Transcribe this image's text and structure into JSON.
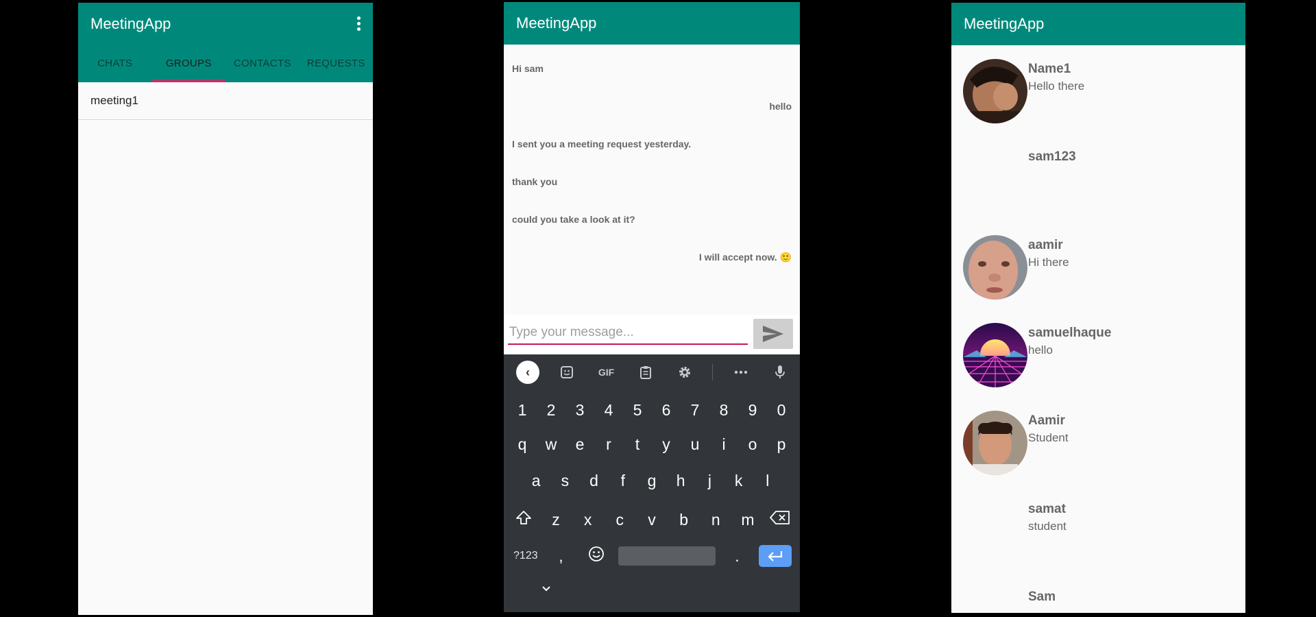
{
  "app_title": "MeetingApp",
  "screen1": {
    "tabs": [
      {
        "label": "CHATS"
      },
      {
        "label": "GROUPS"
      },
      {
        "label": "CONTACTS"
      },
      {
        "label": "REQUESTS"
      }
    ],
    "active_tab": "GROUPS",
    "groups": [
      {
        "name": "meeting1"
      }
    ]
  },
  "screen2": {
    "messages": [
      {
        "text": "Hi sam",
        "side": "left"
      },
      {
        "text": "hello",
        "side": "right"
      },
      {
        "text": "I sent you a meeting request yesterday.",
        "side": "left"
      },
      {
        "text": "thank you",
        "side": "left"
      },
      {
        "text": "could you take a look at it?",
        "side": "left"
      },
      {
        "text": "I will accept now. 🙂",
        "side": "right"
      }
    ],
    "input": {
      "placeholder": "Type your message...",
      "value": ""
    },
    "keyboard": {
      "toolbar": [
        "back-arrow-icon",
        "sticker-icon",
        "GIF",
        "clipboard-icon",
        "gear-icon",
        "more-icon",
        "mic-icon"
      ],
      "gif_label": "GIF",
      "row_numbers": [
        "1",
        "2",
        "3",
        "4",
        "5",
        "6",
        "7",
        "8",
        "9",
        "0"
      ],
      "row_q": [
        "q",
        "w",
        "e",
        "r",
        "t",
        "y",
        "u",
        "i",
        "o",
        "p"
      ],
      "row_a": [
        "a",
        "s",
        "d",
        "f",
        "g",
        "h",
        "j",
        "k",
        "l"
      ],
      "row_z": [
        "z",
        "x",
        "c",
        "v",
        "b",
        "n",
        "m"
      ],
      "symbols_label": "?123",
      "comma": ",",
      "period": "."
    }
  },
  "screen3": {
    "contacts": [
      {
        "name": "Name1",
        "status": "Hello there",
        "avatar": "photo"
      },
      {
        "name": "sam123",
        "status": "",
        "avatar": "none"
      },
      {
        "name": "aamir",
        "status": "Hi there",
        "avatar": "photo"
      },
      {
        "name": "samuelhaque",
        "status": "hello",
        "avatar": "synthwave"
      },
      {
        "name": "Aamir",
        "status": "Student",
        "avatar": "photo"
      },
      {
        "name": "samat",
        "status": "student",
        "avatar": "none"
      },
      {
        "name": "Sam",
        "status": "",
        "avatar": "none"
      }
    ]
  },
  "colors": {
    "primary": "#00897b",
    "accent": "#e91e63",
    "keyboard_bg": "#323539",
    "enter_key": "#5c9ef5"
  }
}
